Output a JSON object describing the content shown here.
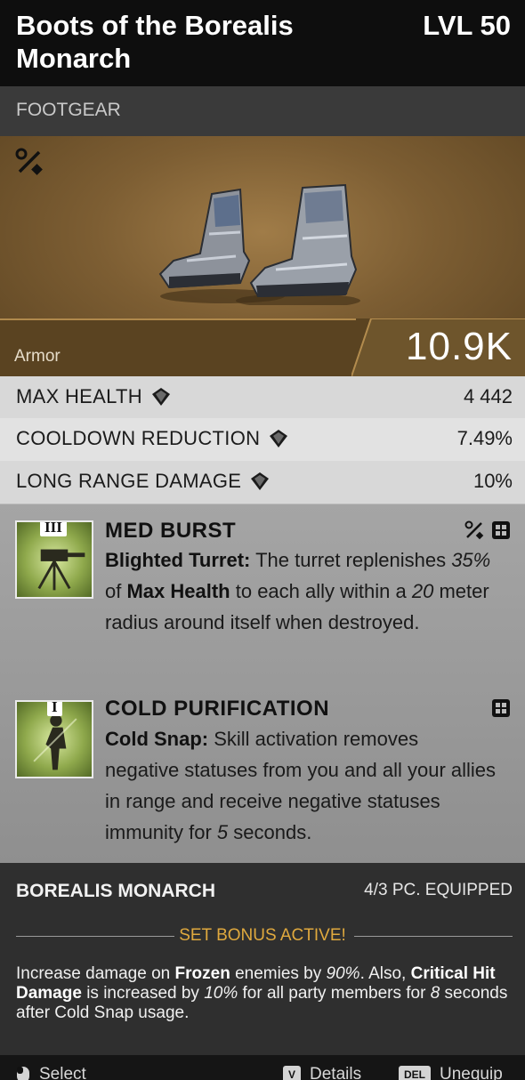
{
  "item": {
    "name": "Boots of the Borealis Monarch",
    "level": "LVL 50",
    "category": "FOOTGEAR",
    "armor_label": "Armor",
    "armor_value": "10.9K"
  },
  "stats": [
    {
      "name": "MAX HEALTH",
      "value": "4 442"
    },
    {
      "name": "COOLDOWN REDUCTION",
      "value": "7.49%"
    },
    {
      "name": "LONG RANGE DAMAGE",
      "value": "10%"
    }
  ],
  "perks": [
    {
      "tier": "III",
      "name": "MED BURST",
      "desc_bold": "Blighted Turret:",
      "desc_a": " The turret replenishes ",
      "desc_i1": "35%",
      "desc_b": " of ",
      "desc_bold2": "Max Health",
      "desc_c": " to each ally within a ",
      "desc_i2": "20",
      "desc_d": " meter radius around itself when destroyed."
    },
    {
      "tier": "I",
      "name": "COLD PURIFICATION",
      "desc_bold": "Cold Snap:",
      "desc_a": " Skill activation removes negative statuses from you and all your allies in range and receive negative statuses immunity for ",
      "desc_i1": "5",
      "desc_b": " seconds."
    }
  ],
  "set": {
    "name": "BOREALIS MONARCH",
    "equipped": "4/3 PC. EQUIPPED",
    "bonus_status": "SET BONUS ACTIVE!",
    "desc_a": "Increase damage on ",
    "desc_bold1": "Frozen",
    "desc_b": " enemies by ",
    "desc_i1": "90%",
    "desc_c": ". Also, ",
    "desc_bold2": "Critical Hit Damage",
    "desc_d": " is increased by ",
    "desc_i2": "10%",
    "desc_e": " for all party members for ",
    "desc_i3": "8",
    "desc_f": " seconds after Cold Snap usage."
  },
  "footer": {
    "select_label": "Select",
    "details_key": "V",
    "details_label": "Details",
    "unequip_key": "DEL",
    "unequip_label": "Unequip"
  },
  "colors": {
    "set_active": "#e0a93e",
    "hero_bg": "#7d5e33"
  },
  "icons": [
    "tools-icon",
    "gem-icon",
    "grid-icon",
    "mouse-icon"
  ]
}
